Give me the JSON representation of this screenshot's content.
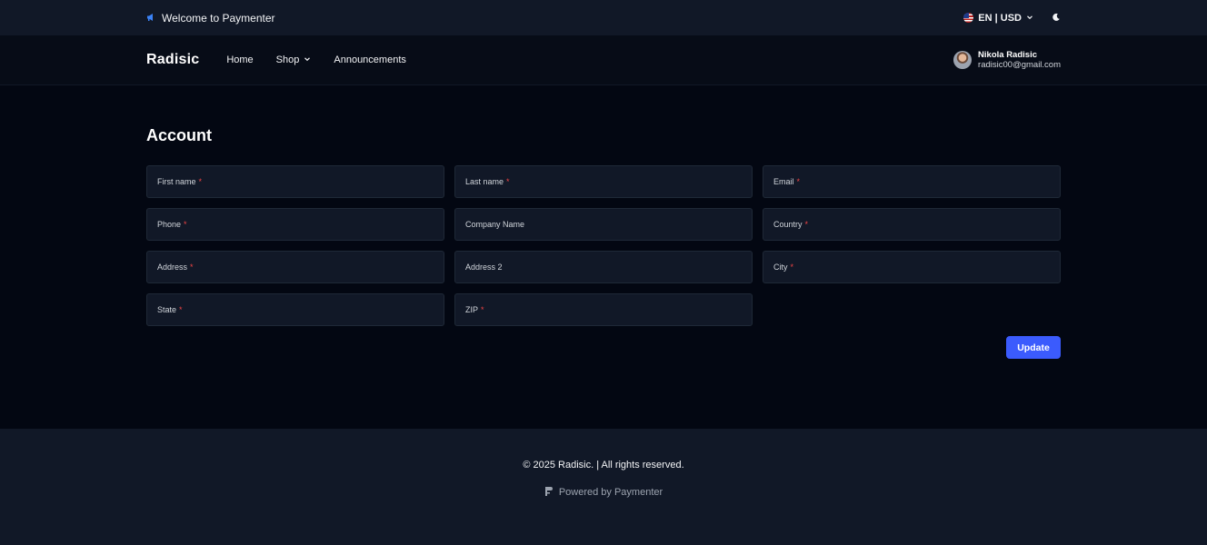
{
  "announcement": {
    "text": "Welcome to Paymenter",
    "icon": "megaphone-icon"
  },
  "locale": {
    "label": "EN | USD",
    "icon": "us-flag-icon"
  },
  "theme_toggle": {
    "icon": "moon-icon"
  },
  "navbar": {
    "brand": "Radisic",
    "links": [
      {
        "label": "Home"
      },
      {
        "label": "Shop",
        "has_dropdown": true
      },
      {
        "label": "Announcements"
      }
    ]
  },
  "user": {
    "name": "Nikola Radisic",
    "email": "radisic00@gmail.com"
  },
  "page": {
    "title": "Account"
  },
  "form": {
    "fields": [
      {
        "label": "First name",
        "required": "*"
      },
      {
        "label": "Last name",
        "required": "*"
      },
      {
        "label": "Email",
        "required": "*"
      },
      {
        "label": "Phone",
        "required": "*"
      },
      {
        "label": "Company Name",
        "required": ""
      },
      {
        "label": "Country",
        "required": "*"
      },
      {
        "label": "Address",
        "required": "*"
      },
      {
        "label": "Address 2",
        "required": ""
      },
      {
        "label": "City",
        "required": "*"
      },
      {
        "label": "State",
        "required": "*"
      },
      {
        "label": "ZIP",
        "required": "*"
      }
    ],
    "submit_label": "Update"
  },
  "footer": {
    "copyright": "© 2025 Radisic. | All rights reserved.",
    "powered_by": "Powered by Paymenter"
  },
  "colors": {
    "accent": "#3b5bfd",
    "required": "#ef4444",
    "background": "#030712",
    "surface": "#111827"
  }
}
